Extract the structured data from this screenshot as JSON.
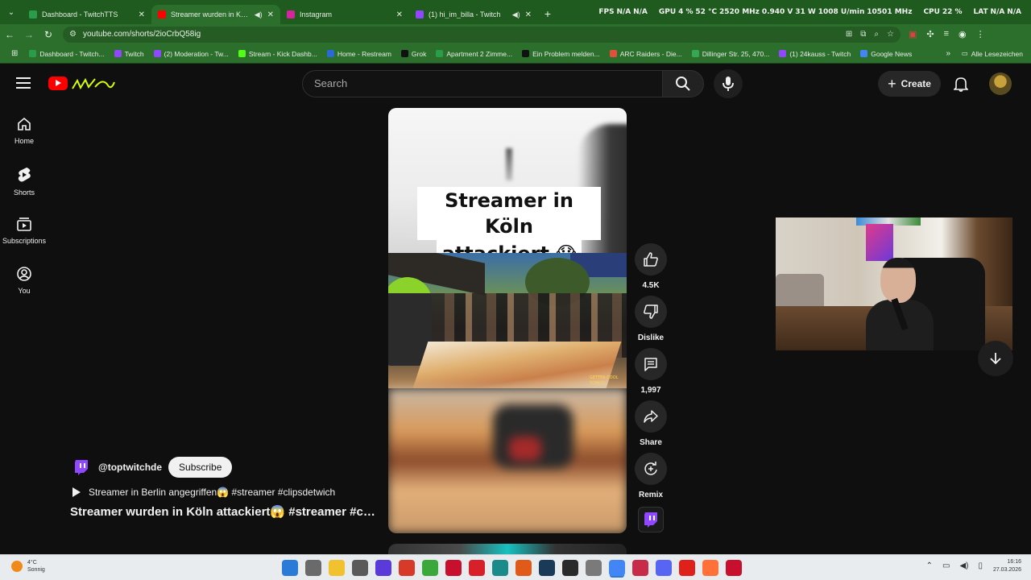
{
  "browser": {
    "tabs": [
      {
        "title": "Dashboard - TwitchTTS",
        "favicon_color": "#2a9d4a",
        "active": false,
        "audio": false
      },
      {
        "title": "Streamer wurden in Köln att",
        "favicon_color": "#ff0000",
        "active": true,
        "audio": true
      },
      {
        "title": "Instagram",
        "favicon_color": "#d6249f",
        "active": false,
        "audio": false
      },
      {
        "title": "(1) hi_im_billa - Twitch",
        "favicon_color": "#9146ff",
        "active": false,
        "audio": true
      }
    ],
    "osd": {
      "fps_label": "FPS",
      "fps_value": "N/A",
      "fps_value2": "N/A",
      "gpu_label": "GPU",
      "gpu_load": "4 %",
      "gpu_temp": "52 °C",
      "gpu_clock": "2520 MHz",
      "gpu_volt": "0.940 V",
      "gpu_power": "31 W",
      "gpu_fan": "1008 U/min",
      "gpu_mem": "10501 MHz",
      "cpu_label": "CPU",
      "cpu_load": "22 %",
      "lat_label": "LAT",
      "lat_value": "N/A",
      "lat_value2": "N/A"
    },
    "url": "youtube.com/shorts/2ioCrbQ58ig",
    "bookmarks": [
      {
        "label": "Dashboard - Twitch...",
        "color": "#2a9d4a"
      },
      {
        "label": "Twitch",
        "color": "#9146ff"
      },
      {
        "label": "(2) Moderation - Tw...",
        "color": "#9146ff"
      },
      {
        "label": "Stream - Kick Dashb...",
        "color": "#53fc18"
      },
      {
        "label": "Home - Restream",
        "color": "#2a6ad8"
      },
      {
        "label": "Grok",
        "color": "#111111"
      },
      {
        "label": "Apartment 2 Zimme...",
        "color": "#2a9d4a"
      },
      {
        "label": "Ein Problem melden...",
        "color": "#111111"
      },
      {
        "label": "ARC Raiders - Die...",
        "color": "#e0503a"
      },
      {
        "label": "Dillinger Str. 25, 470...",
        "color": "#34a853"
      },
      {
        "label": "(1) 24kauss - Twitch",
        "color": "#9146ff"
      },
      {
        "label": "Google News",
        "color": "#4285f4"
      }
    ],
    "all_bookmarks": "Alle Lesezeichen"
  },
  "youtube": {
    "search_placeholder": "Search",
    "create_label": "Create",
    "rail": [
      {
        "label": "Home",
        "icon": "home-icon"
      },
      {
        "label": "Shorts",
        "icon": "shorts-icon"
      },
      {
        "label": "Subscriptions",
        "icon": "subscriptions-icon"
      },
      {
        "label": "You",
        "icon": "you-icon"
      }
    ],
    "short": {
      "caption_line1": "Streamer in Köln",
      "caption_line2": "attackiert 😱",
      "watermark": "GETTER COOL TOMCS",
      "channel_handle": "@toptwitchde",
      "subscribe_label": "Subscribe",
      "playlist_text": "Streamer in Berlin angegriffen😱 #streamer #clipsdetwich",
      "title": "Streamer wurden in Köln attackiert😱 #streamer #clipsdetwich"
    },
    "actions": {
      "like_count": "4.5K",
      "dislike_label": "Dislike",
      "comments_count": "1,997",
      "share_label": "Share",
      "remix_label": "Remix"
    }
  },
  "taskbar": {
    "weather_temp": "4°C",
    "weather_desc": "Sonnig",
    "time": "16:16",
    "date": "27.03.2026",
    "app_colors": [
      "#2a7ad8",
      "#6a6a6a",
      "#f2c12e",
      "#5a5a5a",
      "#5a3ad8",
      "#d83a2a",
      "#3aa83a",
      "#c8102e",
      "#d8202a",
      "#1a8a8a",
      "#e05a1a",
      "#1a3a5a",
      "#2a2a2a",
      "#7a7a7a",
      "#4285f4",
      "#c82a4a",
      "#5865f2",
      "#e0201a",
      "#ff7139",
      "#c8102e"
    ]
  }
}
